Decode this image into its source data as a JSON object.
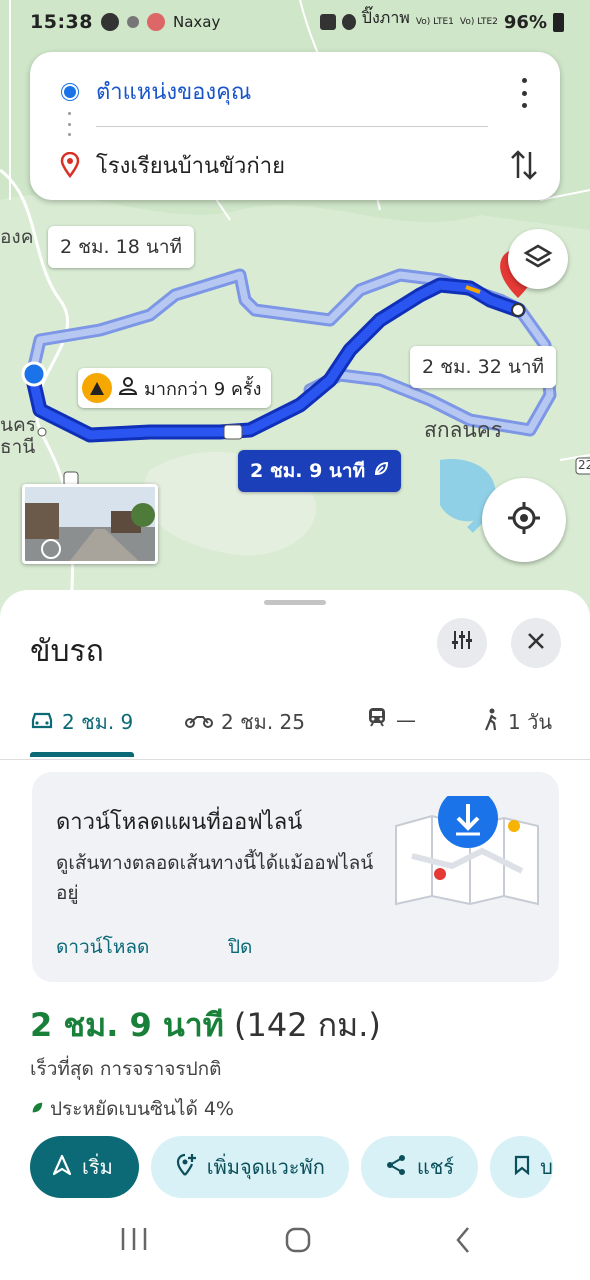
{
  "status_bar": {
    "time": "15:38",
    "carrier_text": "Naxay",
    "network_text": "ปิ๊งภาพ",
    "lte1": "Vo) LTE1",
    "lte2": "Vo) LTE2",
    "battery": "96%"
  },
  "route_card": {
    "origin": "ตำแหน่งของคุณ",
    "destination": "โรงเรียนบ้านขัวก่าย"
  },
  "map": {
    "alt_route_time_1": "2 ชม. 18 นาที",
    "alt_route_time_2": "2 ชม. 32 นาที",
    "main_route_time": "2 ชม. 9 นาที",
    "report_text": "มากกว่า 9 ครั้ง",
    "label_sakon": "สกลนคร",
    "label_left_top": "องค",
    "label_left_1": "นคร",
    "label_left_2": "ธานี",
    "road_number_1": "22",
    "road_number_2": "22",
    "colors": {
      "route_main": "#1a3fe0",
      "route_alt": "#9fb5ea",
      "destination_pin": "#e53935"
    }
  },
  "sheet": {
    "mode_title": "ขับรถ",
    "tabs": [
      {
        "label": "2 ชม. 9",
        "icon": "car-icon"
      },
      {
        "label": "2 ชม. 25",
        "icon": "motorbike-icon"
      },
      {
        "label": "—",
        "icon": "train-icon"
      },
      {
        "label": "1 วัน",
        "icon": "walk-icon"
      }
    ],
    "offline": {
      "title": "ดาวน์โหลดแผนที่ออฟไลน์",
      "description": "ดูเส้นทางตลอดเส้นทางนี้ได้แม้ออฟไลน์อยู่",
      "download_label": "ดาวน์โหลด",
      "close_label": "ปิด"
    },
    "summary": {
      "duration": "2 ชม. 9 นาที",
      "distance": "(142 กม.)",
      "detail": "เร็วที่สุด การจราจรปกติ",
      "eco": "ประหยัดเบนซินได้ 4%"
    },
    "actions": {
      "start": "เริ่ม",
      "add_stop": "เพิ่มจุดแวะพัก",
      "share": "แชร์",
      "save": "บ"
    }
  }
}
